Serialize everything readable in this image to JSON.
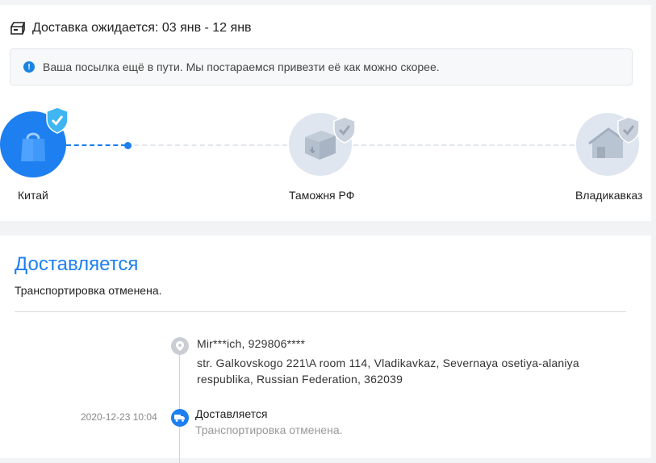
{
  "header": {
    "eta_text": "Доставка ожидается: 03 янв - 12 янв",
    "notice_text": "Ваша посылка ещё в пути. Мы постараемся привезти её как можно скорее."
  },
  "route": {
    "stages": [
      {
        "label": "Китай",
        "state": "active"
      },
      {
        "label": "Таможня РФ",
        "state": "pending"
      },
      {
        "label": "Владикавказ",
        "state": "pending"
      }
    ]
  },
  "status": {
    "title": "Доставляется",
    "subtitle": "Транспортировка отменена."
  },
  "address": {
    "name_phone": "Mir***ich,  929806****",
    "line1": "str. Galkovskogo 221\\A room 114,  Vladikavkaz,  Severnaya osetiya-alaniya",
    "line2": "respublika,  Russian Federation,  362039"
  },
  "events": [
    {
      "time": "2020-12-23 10:04",
      "title": "Доставляется",
      "desc": "Транспортировка отменена."
    }
  ],
  "colors": {
    "accent": "#1d7ff0",
    "muted_node": "#dfe6ef"
  }
}
